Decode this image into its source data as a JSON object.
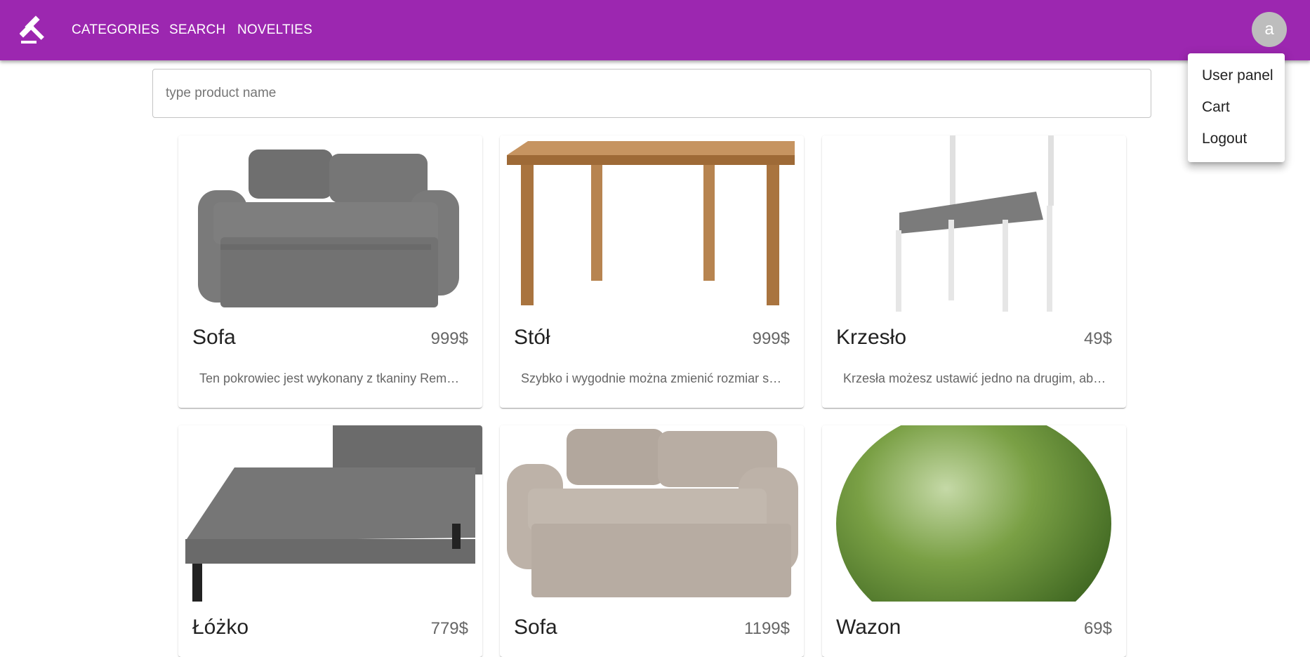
{
  "header": {
    "brand_color": "#9c27b0",
    "logo_icon": "gavel-icon",
    "nav": [
      {
        "label": "CATEGORIES"
      },
      {
        "label": "SEARCH"
      },
      {
        "label": "NOVELTIES"
      }
    ],
    "avatar_letter": "a"
  },
  "search": {
    "placeholder": "type product name",
    "value": ""
  },
  "user_menu": {
    "items": [
      {
        "label": "User panel"
      },
      {
        "label": "Cart"
      },
      {
        "label": "Logout"
      }
    ]
  },
  "products": [
    {
      "title": "Sofa",
      "price": "999$",
      "description": "Ten pokrowiec jest wykonany z tkaniny Remmarn…",
      "image": "grey-sofa-image",
      "color": "#7d7d7d"
    },
    {
      "title": "Stół",
      "price": "999$",
      "description": "Szybko i wygodnie można zmienić rozmiar stołu…",
      "image": "wooden-table-image",
      "color": "#a9743f"
    },
    {
      "title": "Krzesło",
      "price": "49$",
      "description": "Krzesła możesz ustawić jedno na drugim, aby…",
      "image": "grey-chair-image",
      "color": "#7b7b7b"
    },
    {
      "title": "Łóżko",
      "price": "779$",
      "description": "",
      "image": "grey-bed-image",
      "color": "#6f6f6f"
    },
    {
      "title": "Sofa",
      "price": "1199$",
      "description": "",
      "image": "beige-sofa-image",
      "color": "#b7aca2"
    },
    {
      "title": "Wazon",
      "price": "69$",
      "description": "",
      "image": "green-vase-image",
      "color": "#5d8b2f"
    }
  ]
}
